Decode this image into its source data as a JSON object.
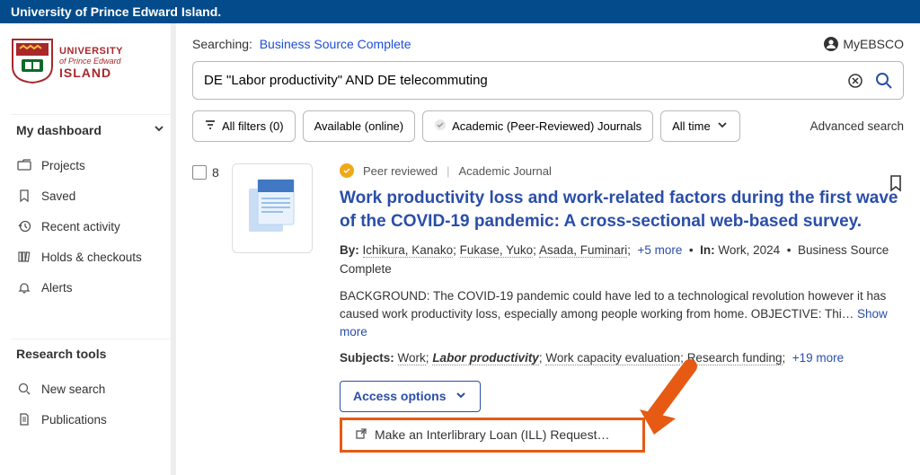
{
  "topbar": {
    "org": "University of Prince Edward Island."
  },
  "logo": {
    "line1": "UNIVERSITY",
    "line2": "of Prince Edward",
    "line3": "ISLAND"
  },
  "sidebar": {
    "dashboard_title": "My dashboard",
    "items": [
      {
        "label": "Projects"
      },
      {
        "label": "Saved"
      },
      {
        "label": "Recent activity"
      },
      {
        "label": "Holds & checkouts"
      },
      {
        "label": "Alerts"
      }
    ],
    "research_title": "Research tools",
    "research_items": [
      {
        "label": "New search"
      },
      {
        "label": "Publications"
      }
    ]
  },
  "header": {
    "searching_label": "Searching:",
    "searching_source": "Business Source Complete",
    "myebsco": "MyEBSCO"
  },
  "search": {
    "value": "DE \"Labor productivity\" AND DE telecommuting"
  },
  "filters": {
    "all": "All filters (0)",
    "available": "Available (online)",
    "peer": "Academic (Peer-Reviewed) Journals",
    "alltime": "All time",
    "advanced": "Advanced search"
  },
  "result": {
    "number": "8",
    "peer_reviewed": "Peer reviewed",
    "type": "Academic Journal",
    "title": "Work productivity loss and work-related factors during the first wave of the COVID-19 pandemic: A cross-sectional web-based survey.",
    "by_label": "By:",
    "authors": [
      "Ichikura, Kanako",
      "Fukase, Yuko",
      "Asada, Fuminari"
    ],
    "authors_more": "+5 more",
    "in_label": "In:",
    "in_value": "Work, 2024",
    "source_db": "Business Source Complete",
    "abstract": "BACKGROUND: The COVID-19 pandemic could have led to a technological revolution however it has caused work productivity loss, especially among people working from home. OBJECTIVE: Thi…",
    "show_more": "Show more",
    "subjects_label": "Subjects:",
    "subjects": [
      "Work",
      "Labor productivity",
      "Work capacity evaluation",
      "Research funding"
    ],
    "subjects_more": "+19 more",
    "access_label": "Access options",
    "ill_label": "Make an Interlibrary Loan (ILL) Request…"
  }
}
